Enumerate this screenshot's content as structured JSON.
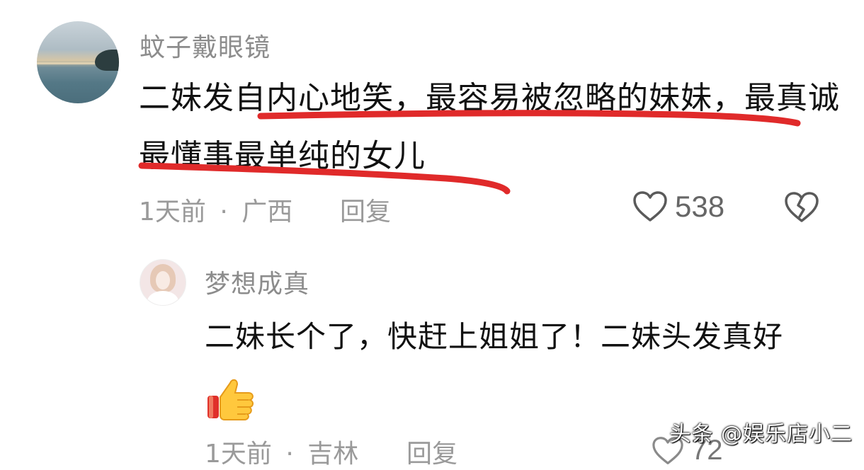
{
  "comment": {
    "username": "蚊子戴眼镜",
    "text": "二妹发自内心地笑，最容易被忽略的妹妹，最真诚最懂事最单纯的女儿",
    "time": "1天前",
    "separator": "·",
    "location": "广西",
    "reply_label": "回复",
    "like_count": "538",
    "annotation_color": "#e02a2a"
  },
  "reply": {
    "username": "梦想成真",
    "text": "二妹长个了，快赶上姐姐了！二妹头发真好",
    "emoji": "thumbs-up",
    "time": "1天前",
    "separator": "·",
    "location": "吉林",
    "reply_label": "回复",
    "like_count": "72"
  },
  "watermark": "头条 @娱乐店小二"
}
